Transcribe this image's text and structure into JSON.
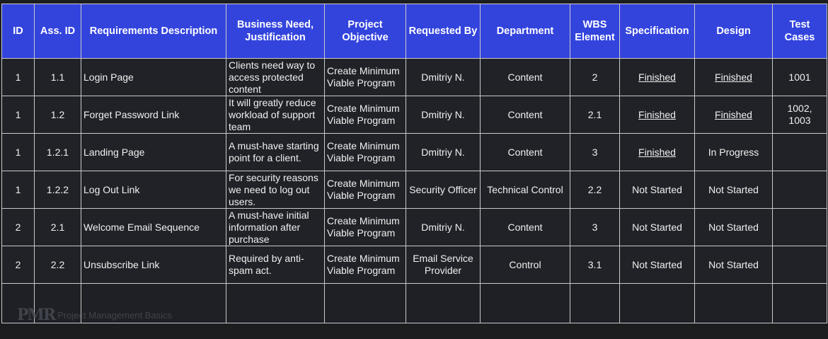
{
  "headers": [
    {
      "key": "id",
      "label": "ID"
    },
    {
      "key": "ass_id",
      "label": "Ass. ID"
    },
    {
      "key": "desc",
      "label": "Requirements Description"
    },
    {
      "key": "need",
      "label": "Business Need, Justification"
    },
    {
      "key": "objective",
      "label": "Project Objective"
    },
    {
      "key": "requested_by",
      "label": "Requested By"
    },
    {
      "key": "department",
      "label": "Department"
    },
    {
      "key": "wbs",
      "label": "WBS Element"
    },
    {
      "key": "spec",
      "label": "Specification"
    },
    {
      "key": "design",
      "label": "Design"
    },
    {
      "key": "tests",
      "label": "Test Cases"
    }
  ],
  "rows": [
    {
      "id": "1",
      "ass_id": "1.1",
      "desc": "Login Page",
      "need": "Clients need way to access protected content",
      "objective": "Create Minimum Viable Program",
      "requested_by": "Dmitriy N.",
      "department": "Content",
      "wbs": "2",
      "spec": "Finished",
      "design": "Finished",
      "tests": "1001"
    },
    {
      "id": "1",
      "ass_id": "1.2",
      "desc": "Forget Password Link",
      "need": "It will greatly reduce workload of support team",
      "objective": "Create Minimum Viable Program",
      "requested_by": "Dmitriy N.",
      "department": "Content",
      "wbs": "2.1",
      "spec": "Finished",
      "design": "Finished",
      "tests": "1002, 1003"
    },
    {
      "id": "1",
      "ass_id": "1.2.1",
      "desc": "Landing Page",
      "need": "A must-have starting point for a client.",
      "objective": "Create Minimum Viable Program",
      "requested_by": "Dmitriy N.",
      "department": "Content",
      "wbs": "3",
      "spec": "Finished",
      "design": "In Progress",
      "tests": ""
    },
    {
      "id": "1",
      "ass_id": "1.2.2",
      "desc": "Log Out Link",
      "need": "For security reasons we need to log out users.",
      "objective": "Create Minimum Viable Program",
      "requested_by": "Security Officer",
      "department": "Technical Control",
      "wbs": "2.2",
      "spec": "Not Started",
      "design": "Not Started",
      "tests": ""
    },
    {
      "id": "2",
      "ass_id": "2.1",
      "desc": "Welcome Email Sequence",
      "need": "A must-have initial information after purchase",
      "objective": "Create Minimum Viable Program",
      "requested_by": "Dmitriy N.",
      "department": "Content",
      "wbs": "3",
      "spec": "Not Started",
      "design": "Not Started",
      "tests": ""
    },
    {
      "id": "2",
      "ass_id": "2.2",
      "desc": "Unsubscribe Link",
      "need": "Required by anti-spam act.",
      "objective": "Create Minimum Viable Program",
      "requested_by": "Email Service Provider",
      "department": "Control",
      "wbs": "3.1",
      "spec": "Not Started",
      "design": "Not Started",
      "tests": ""
    }
  ],
  "underlined_status": "Finished",
  "colors": {
    "header_bg": "#3344dd",
    "cell_bg": "#202227",
    "grid": "#c9c9c9",
    "page_bg": "#1c1d1f"
  },
  "watermark": {
    "logo": "PMR",
    "text": "Project Management Basics"
  }
}
